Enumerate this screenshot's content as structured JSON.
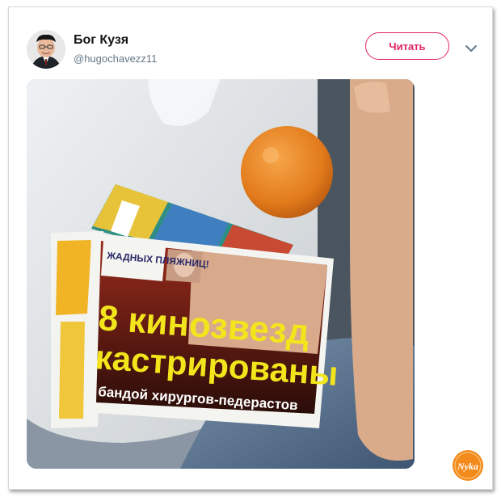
{
  "tweet": {
    "author_name": "Бог Кузя",
    "author_handle": "@hugochavezz11",
    "follow_label": "Читать"
  },
  "photo": {
    "magazine_corner_text": "ЖАДНЫХ ПЛЯЖНИЦ!",
    "headline_line1": "8 кинозвезд",
    "headline_line2": "кастрированы",
    "headline_line3": "бандой хирургов-педерастов"
  },
  "watermark": {
    "text": "Nyka"
  },
  "colors": {
    "accent": "#e0245e",
    "handle": "#657786",
    "name": "#14171a",
    "headline": "#f3e51c"
  }
}
